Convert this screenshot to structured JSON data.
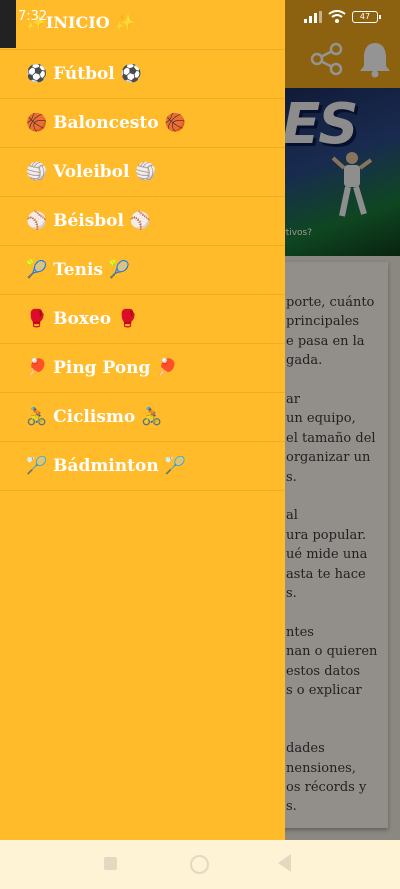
{
  "status_bar": {
    "time": "7:32",
    "battery": "47"
  },
  "app_background": {
    "hero_title": "ES",
    "hero_caption": "rtivos?",
    "card_lines": [
      "porte, cuánto",
      "principales",
      "e pasa en la",
      "gada.",
      "",
      "ar",
      "un equipo,",
      "el tamaño del",
      "organizar un",
      "s.",
      "",
      "al",
      "ura popular.",
      "ué mide una",
      "asta te hace",
      "s.",
      "",
      "ntes",
      "nan o quieren",
      "estos datos",
      "s o explicar",
      "",
      "",
      "dades",
      "nensiones,",
      "os récords y",
      "s."
    ],
    "accent_color": "#f2a81c"
  },
  "drawer": {
    "background_color": "#ffbb2a",
    "items": [
      {
        "label": "✨INICIO ✨",
        "icon": "sparkles-icon"
      },
      {
        "label": "⚽ Fútbol ⚽",
        "icon": "soccer-ball-icon"
      },
      {
        "label": "🏀 Baloncesto 🏀",
        "icon": "basketball-icon"
      },
      {
        "label": "🏐 Voleibol 🏐",
        "icon": "volleyball-icon"
      },
      {
        "label": "⚾ Béisbol ⚾",
        "icon": "baseball-icon"
      },
      {
        "label": "🎾 Tenis 🎾",
        "icon": "tennis-icon"
      },
      {
        "label": "🥊 Boxeo 🥊",
        "icon": "boxing-glove-icon"
      },
      {
        "label": "🏓 Ping Pong 🏓",
        "icon": "ping-pong-icon"
      },
      {
        "label": "🚴 Ciclismo 🚴",
        "icon": "cyclist-icon"
      },
      {
        "label": "🏸 Bádminton 🏸",
        "icon": "badminton-icon"
      }
    ]
  },
  "nav_bar": {
    "icons": [
      "recents-icon",
      "home-icon",
      "back-icon"
    ]
  }
}
